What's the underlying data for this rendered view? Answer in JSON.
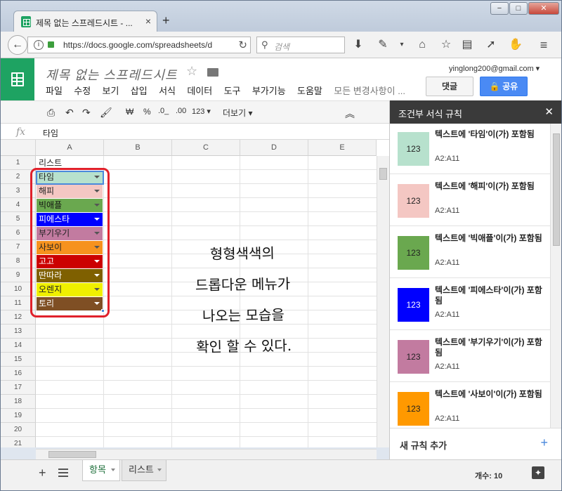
{
  "browser": {
    "tab_title": "제목 없는 스프레드시트 - ...",
    "url": "https://docs.google.com/spreadsheets/d",
    "search_placeholder": "검색",
    "window_buttons": [
      "−",
      "□",
      "✕"
    ]
  },
  "app": {
    "title": "제목 없는 스프레드시트",
    "menu": [
      "파일",
      "수정",
      "보기",
      "삽입",
      "서식",
      "데이터",
      "도구",
      "부가기능",
      "도움말"
    ],
    "changes_saved": "모든 변경사항이 ...",
    "account_email": "yinglong200@gmail.com",
    "comments_label": "댓글",
    "share_label": "공유"
  },
  "toolbar": {
    "currency": "₩",
    "percent": "%",
    "dec_minus": ".0_",
    "dec_plus": ".00",
    "format_123": "123",
    "more": "더보기"
  },
  "formula_bar": {
    "fx": "fx",
    "value": "타임"
  },
  "grid": {
    "columns": [
      "A",
      "B",
      "C",
      "D",
      "E"
    ],
    "rows": [
      "1",
      "2",
      "3",
      "4",
      "5",
      "6",
      "7",
      "8",
      "9",
      "10",
      "11",
      "12",
      "13",
      "14",
      "15",
      "16",
      "17",
      "18",
      "19",
      "20",
      "21"
    ],
    "a1": "리스트",
    "items": [
      {
        "label": "타임",
        "bg": "#b7e1cd",
        "fg": "#222222"
      },
      {
        "label": "해피",
        "bg": "#f4c7c3",
        "fg": "#222222"
      },
      {
        "label": "빅애플",
        "bg": "#6aa84f",
        "fg": "#111111"
      },
      {
        "label": "피에스타",
        "bg": "#0000ff",
        "fg": "#ffffff"
      },
      {
        "label": "부기우기",
        "bg": "#c27ba0",
        "fg": "#222222"
      },
      {
        "label": "사보이",
        "bg": "#f6921e",
        "fg": "#222222"
      },
      {
        "label": "고고",
        "bg": "#cc0000",
        "fg": "#ffffff"
      },
      {
        "label": "딴따라",
        "bg": "#7f6000",
        "fg": "#ffffff"
      },
      {
        "label": "오렌지",
        "bg": "#f0f000",
        "fg": "#222222"
      },
      {
        "label": "토리",
        "bg": "#7f4f24",
        "fg": "#ffffff"
      }
    ]
  },
  "annotation": [
    "형형색색의",
    "드롭다운 메뉴가",
    "나오는 모습을",
    "확인 할 수 있다."
  ],
  "sheets": {
    "tabs": [
      "항목",
      "리스트"
    ],
    "status": "개수: 10"
  },
  "panel": {
    "title": "조건부 서식 규칙",
    "rules": [
      {
        "swatch": "123",
        "color": "#b7e1cd",
        "text": "텍스트에 '타임'이(가) 포함됨",
        "range": "A2:A11"
      },
      {
        "swatch": "123",
        "color": "#f4c7c3",
        "text": "텍스트에 '해피'이(가) 포함됨",
        "range": "A2:A11"
      },
      {
        "swatch": "123",
        "color": "#6aa84f",
        "text": "텍스트에 '빅애플'이(가) 포함됨",
        "range": "A2:A11"
      },
      {
        "swatch": "123",
        "color": "#0000ff",
        "text": "텍스트에 '피에스타'이(가) 포함됨",
        "range": "A2:A11"
      },
      {
        "swatch": "123",
        "color": "#c27ba0",
        "text": "텍스트에 '부기우기'이(가) 포함됨",
        "range": "A2:A11"
      },
      {
        "swatch": "123",
        "color": "#ff9900",
        "text": "텍스트에 '사보이'이(가) 포함됨",
        "range": "A2:A11"
      }
    ],
    "add_rule": "새 규칙 추가",
    "add_icon": "+"
  }
}
